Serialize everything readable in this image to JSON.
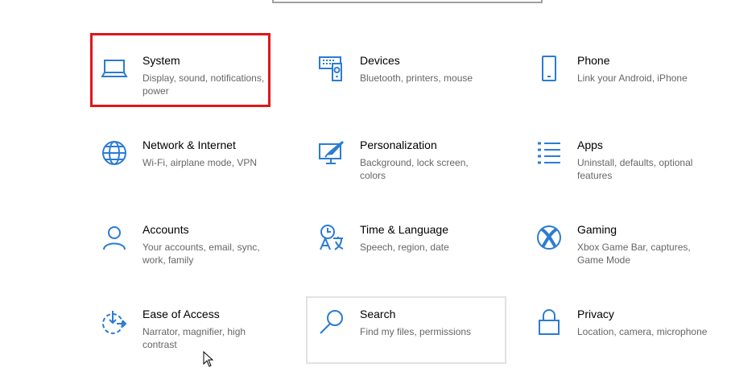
{
  "accent": "#2b7cd3",
  "tiles": [
    {
      "title": "System",
      "subtitle": "Display, sound, notifications, power",
      "icon": "laptop-icon"
    },
    {
      "title": "Devices",
      "subtitle": "Bluetooth, printers, mouse",
      "icon": "devices-icon"
    },
    {
      "title": "Phone",
      "subtitle": "Link your Android, iPhone",
      "icon": "phone-icon"
    },
    {
      "title": "Network & Internet",
      "subtitle": "Wi-Fi, airplane mode, VPN",
      "icon": "globe-icon"
    },
    {
      "title": "Personalization",
      "subtitle": "Background, lock screen, colors",
      "icon": "paint-icon"
    },
    {
      "title": "Apps",
      "subtitle": "Uninstall, defaults, optional features",
      "icon": "apps-list-icon"
    },
    {
      "title": "Accounts",
      "subtitle": "Your accounts, email, sync, work, family",
      "icon": "person-icon"
    },
    {
      "title": "Time & Language",
      "subtitle": "Speech, region, date",
      "icon": "time-language-icon"
    },
    {
      "title": "Gaming",
      "subtitle": "Xbox Game Bar, captures, Game Mode",
      "icon": "xbox-icon"
    },
    {
      "title": "Ease of Access",
      "subtitle": "Narrator, magnifier, high contrast",
      "icon": "ease-of-access-icon"
    },
    {
      "title": "Search",
      "subtitle": "Find my files, permissions",
      "icon": "search-icon"
    },
    {
      "title": "Privacy",
      "subtitle": "Location, camera, microphone",
      "icon": "lock-icon"
    }
  ]
}
